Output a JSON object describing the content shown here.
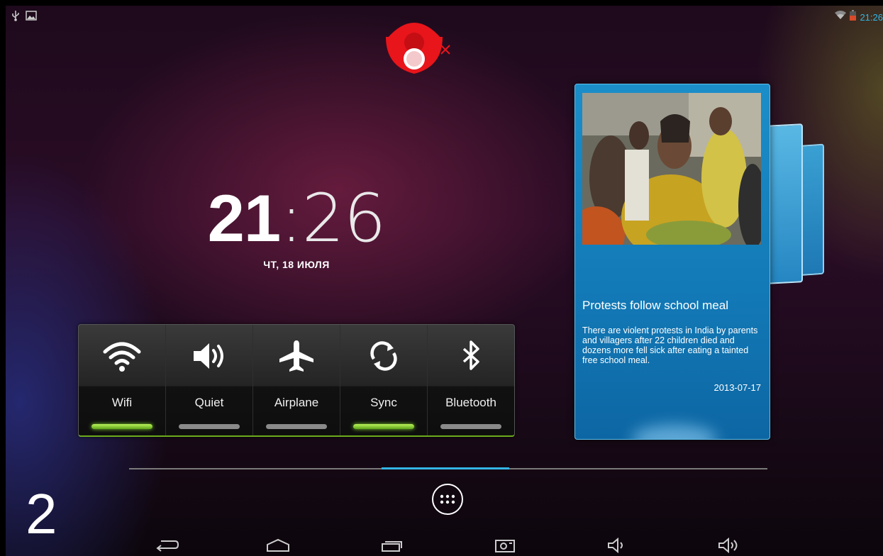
{
  "status_bar": {
    "time": "21:26",
    "left_icons": [
      "usb-icon",
      "image-notification-icon"
    ],
    "right_icons": [
      "wifi-signal-icon",
      "battery-icon"
    ]
  },
  "lock_handle": {
    "icon": "camera-lock-handle-icon",
    "accent": "#e8151b"
  },
  "clock": {
    "hours": "21",
    "separator": ":",
    "minutes": "26",
    "date": "ЧТ, 18 ИЮЛЯ"
  },
  "quick_settings": {
    "tiles": [
      {
        "label": "Wifi",
        "icon": "wifi-icon",
        "on": true
      },
      {
        "label": "Quiet",
        "icon": "speaker-icon",
        "on": false
      },
      {
        "label": "Airplane",
        "icon": "airplane-icon",
        "on": false
      },
      {
        "label": "Sync",
        "icon": "sync-icon",
        "on": true
      },
      {
        "label": "Bluetooth",
        "icon": "bluetooth-icon",
        "on": false
      }
    ],
    "on_color": "#7ccc2a",
    "off_color": "#8a8a8a"
  },
  "news_widget": {
    "title": "Protests follow school meal",
    "body": "There are violent protests in India by parents and villagers after 22 children died and dozens more fell sick after eating a tainted free school meal.",
    "date": "2013-07-17",
    "accent": "#1b8ec9"
  },
  "page_indicator": {
    "accent": "#33b5e5"
  },
  "apps_button": {
    "icon": "all-apps-icon"
  },
  "navigation_bar": {
    "buttons": [
      "back-icon",
      "home-icon",
      "recent-apps-icon",
      "screenshot-icon",
      "volume-down-icon",
      "volume-up-icon"
    ]
  },
  "overlay_number": "2"
}
